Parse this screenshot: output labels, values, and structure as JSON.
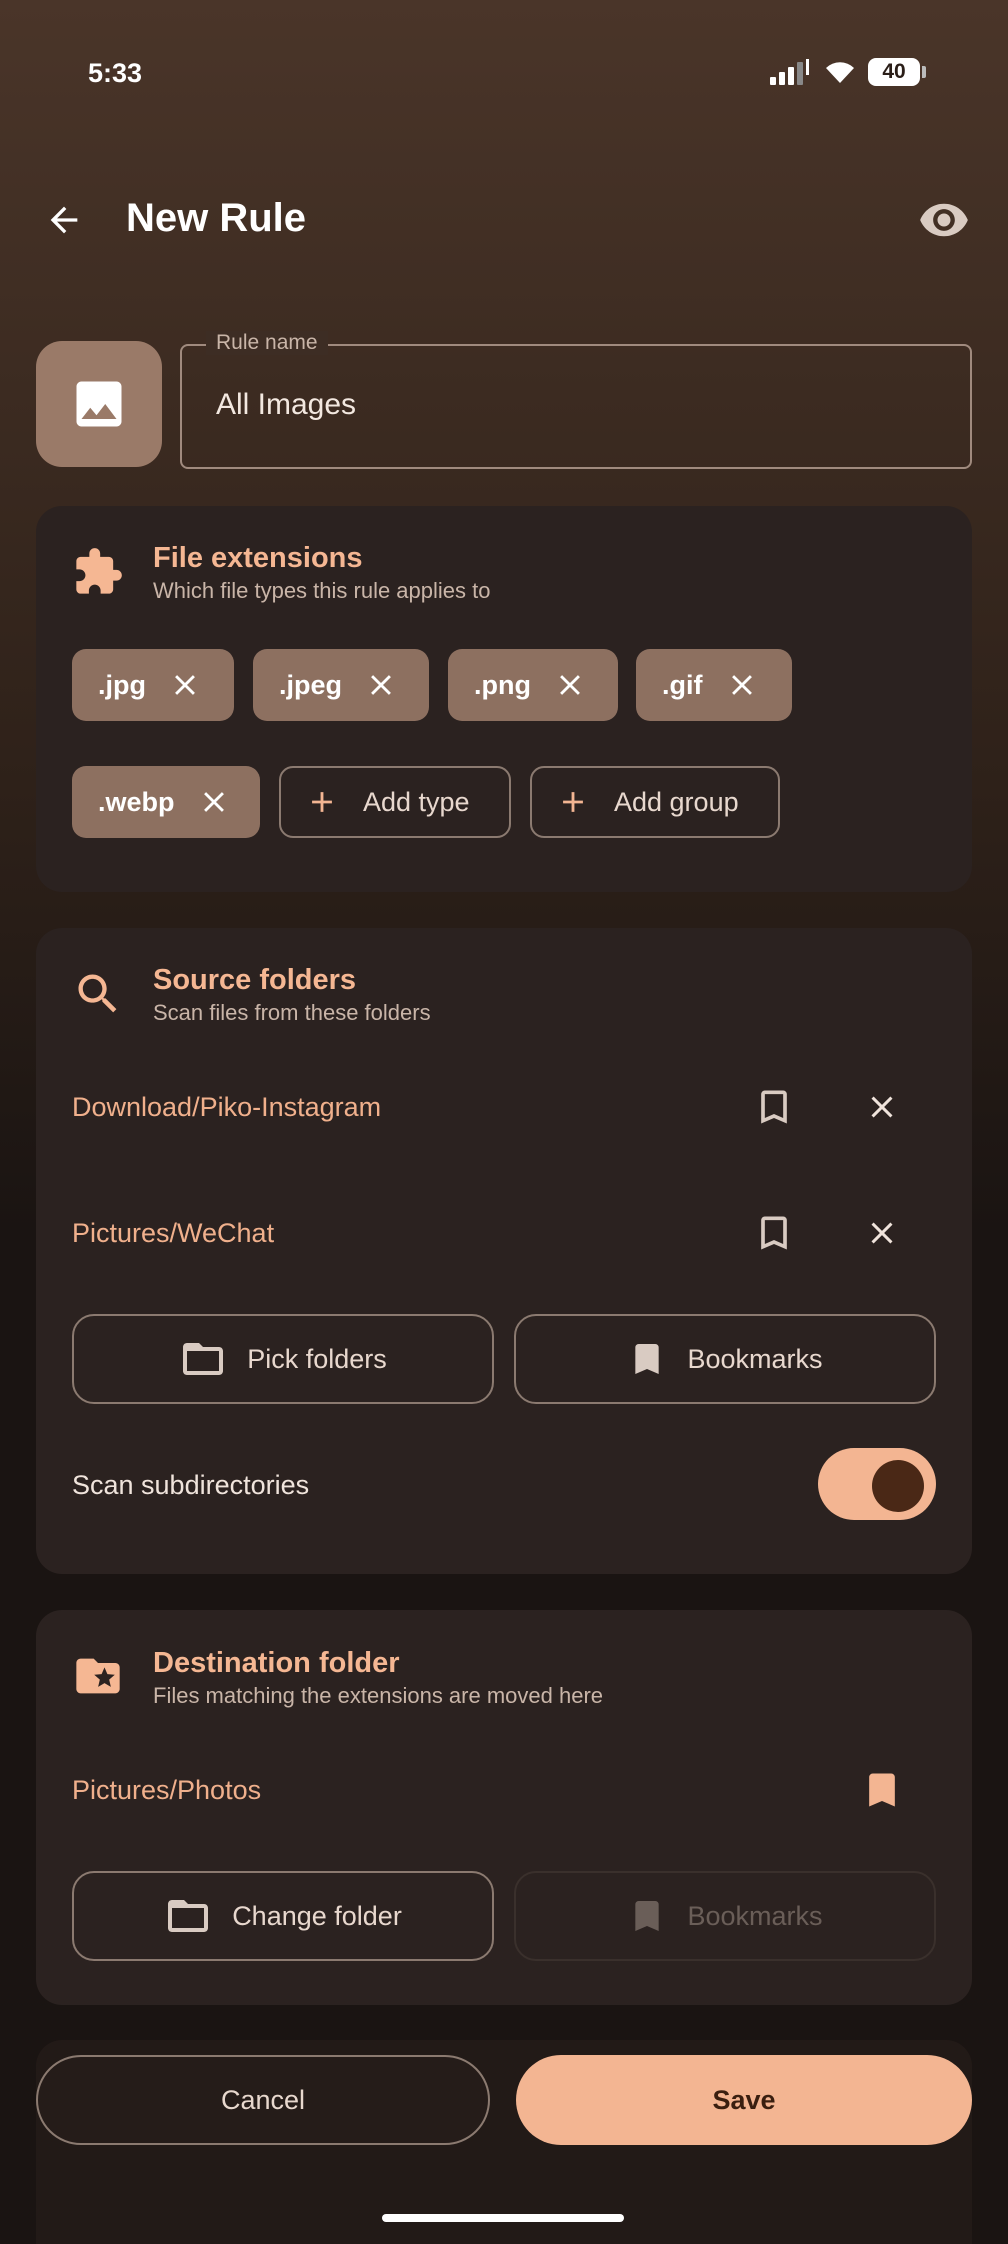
{
  "status_bar": {
    "time": "5:33",
    "battery": "40"
  },
  "header": {
    "title": "New Rule"
  },
  "rule_name": {
    "label": "Rule name",
    "value": "All Images"
  },
  "extensions": {
    "title": "File extensions",
    "subtitle": "Which file types this rule applies to",
    "chips": [
      ".jpg",
      ".jpeg",
      ".png",
      ".gif",
      ".webp"
    ],
    "add_type": "Add type",
    "add_group": "Add group"
  },
  "source": {
    "title": "Source folders",
    "subtitle": "Scan files from these folders",
    "folders": [
      "Download/Piko-Instagram",
      "Pictures/WeChat"
    ],
    "pick_folders": "Pick folders",
    "bookmarks": "Bookmarks",
    "scan_subdirs_label": "Scan subdirectories",
    "scan_subdirs_on": true
  },
  "destination": {
    "title": "Destination folder",
    "subtitle": "Files matching the extensions are moved here",
    "folder": "Pictures/Photos",
    "change_folder": "Change folder",
    "bookmarks": "Bookmarks"
  },
  "actions": {
    "cancel": "Cancel",
    "save": "Save"
  },
  "colors": {
    "accent": "#f3b592",
    "chip": "#8d7060",
    "card": "#2b2220"
  }
}
